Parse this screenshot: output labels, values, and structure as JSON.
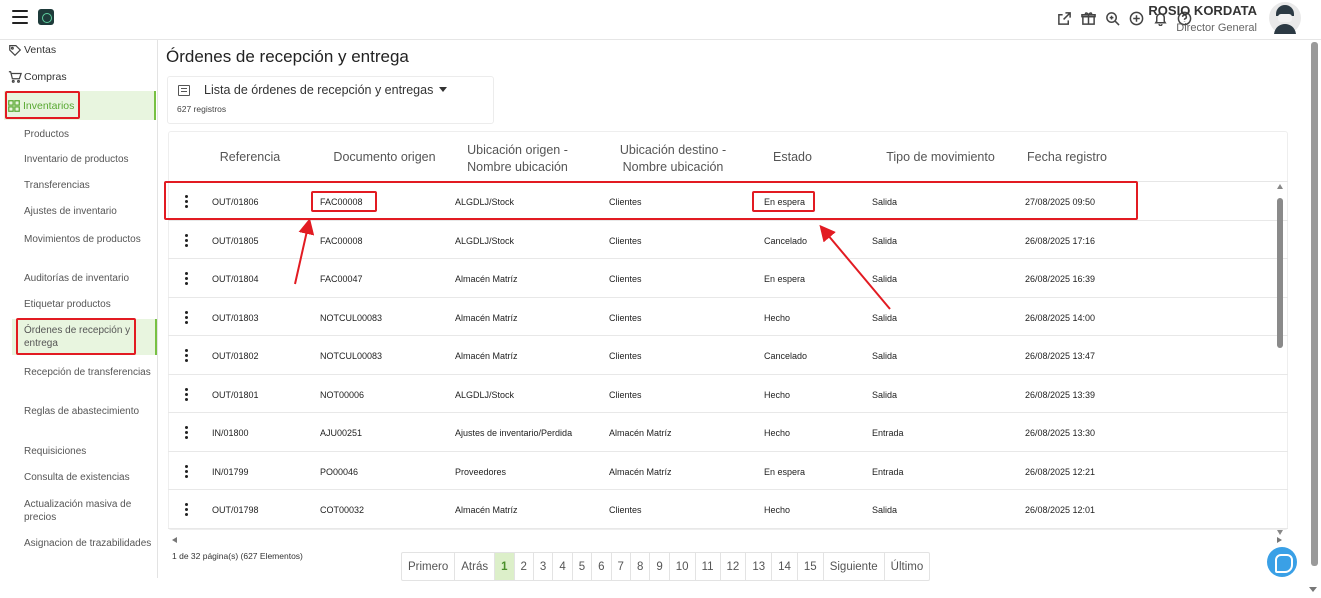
{
  "header": {
    "user_name": "ROSIO KORDATA",
    "user_role": "Director General",
    "icons": [
      "external-link-icon",
      "gift-icon",
      "search-zoom-icon",
      "add-circle-icon",
      "bell-icon",
      "help-icon"
    ]
  },
  "sidebar": {
    "top_items": [
      {
        "label": "Ventas",
        "icon": "sales-icon"
      },
      {
        "label": "Compras",
        "icon": "cart-icon"
      },
      {
        "label": "Inventarios",
        "icon": "inventory-icon",
        "active": true
      }
    ],
    "sub_items": [
      {
        "label": "Productos"
      },
      {
        "label": "Inventario de productos"
      },
      {
        "label": "Transferencias"
      },
      {
        "label": "Ajustes de inventario"
      },
      {
        "label": "Movimientos de productos"
      },
      {
        "label": "Auditorías de inventario"
      },
      {
        "label": "Etiquetar productos"
      },
      {
        "label": "Órdenes de recepción y entrega",
        "active": true
      },
      {
        "label": "Recepción de transferencias"
      },
      {
        "label": "Reglas de abastecimiento"
      },
      {
        "label": "Requisiciones"
      },
      {
        "label": "Consulta de existencias"
      },
      {
        "label": "Actualización masiva de precios"
      },
      {
        "label": "Asignacion de trazabilidades"
      }
    ]
  },
  "main": {
    "title": "Órdenes de recepción y entrega",
    "list_title": "Lista de órdenes de recepción y entregas",
    "record_count": "627 registros"
  },
  "table": {
    "columns": [
      "Referencia",
      "Documento origen",
      "Ubicación origen - Nombre ubicación",
      "Ubicación destino - Nombre ubicación",
      "Estado",
      "Tipo de movimiento",
      "Fecha registro"
    ],
    "rows": [
      {
        "ref": "OUT/01806",
        "doc": "FAC00008",
        "origen": "ALGDLJ/Stock",
        "destino": "Clientes",
        "estado": "En espera",
        "tipo": "Salida",
        "fecha": "27/08/2025 09:50"
      },
      {
        "ref": "OUT/01805",
        "doc": "FAC00008",
        "origen": "ALGDLJ/Stock",
        "destino": "Clientes",
        "estado": "Cancelado",
        "tipo": "Salida",
        "fecha": "26/08/2025 17:16"
      },
      {
        "ref": "OUT/01804",
        "doc": "FAC00047",
        "origen": "Almacén Matríz",
        "destino": "Clientes",
        "estado": "En espera",
        "tipo": "Salida",
        "fecha": "26/08/2025 16:39"
      },
      {
        "ref": "OUT/01803",
        "doc": "NOTCUL00083",
        "origen": "Almacén Matríz",
        "destino": "Clientes",
        "estado": "Hecho",
        "tipo": "Salida",
        "fecha": "26/08/2025 14:00"
      },
      {
        "ref": "OUT/01802",
        "doc": "NOTCUL00083",
        "origen": "Almacén Matríz",
        "destino": "Clientes",
        "estado": "Cancelado",
        "tipo": "Salida",
        "fecha": "26/08/2025 13:47"
      },
      {
        "ref": "OUT/01801",
        "doc": "NOT00006",
        "origen": "ALGDLJ/Stock",
        "destino": "Clientes",
        "estado": "Hecho",
        "tipo": "Salida",
        "fecha": "26/08/2025 13:39"
      },
      {
        "ref": "IN/01800",
        "doc": "AJU00251",
        "origen": "Ajustes de inventario/Perdida",
        "destino": "Almacén Matríz",
        "estado": "Hecho",
        "tipo": "Entrada",
        "fecha": "26/08/2025 13:30"
      },
      {
        "ref": "IN/01799",
        "doc": "PO00046",
        "origen": "Proveedores",
        "destino": "Almacén Matríz",
        "estado": "En espera",
        "tipo": "Entrada",
        "fecha": "26/08/2025 12:21"
      },
      {
        "ref": "OUT/01798",
        "doc": "COT00032",
        "origen": "Almacén Matríz",
        "destino": "Clientes",
        "estado": "Hecho",
        "tipo": "Salida",
        "fecha": "26/08/2025 12:01"
      }
    ]
  },
  "pagination": {
    "info": "1 de 32 página(s) (627 Elementos)",
    "first": "Primero",
    "prev": "Atrás",
    "pages": [
      "1",
      "2",
      "3",
      "4",
      "5",
      "6",
      "7",
      "8",
      "9",
      "10",
      "11",
      "12",
      "13",
      "14",
      "15"
    ],
    "current_page": "1",
    "next": "Siguiente",
    "last": "Último"
  },
  "colors": {
    "accent_green": "#77c043",
    "active_bg": "#e8f5df",
    "annotation_red": "#e21b22",
    "chat_blue": "#3aa0e6"
  }
}
